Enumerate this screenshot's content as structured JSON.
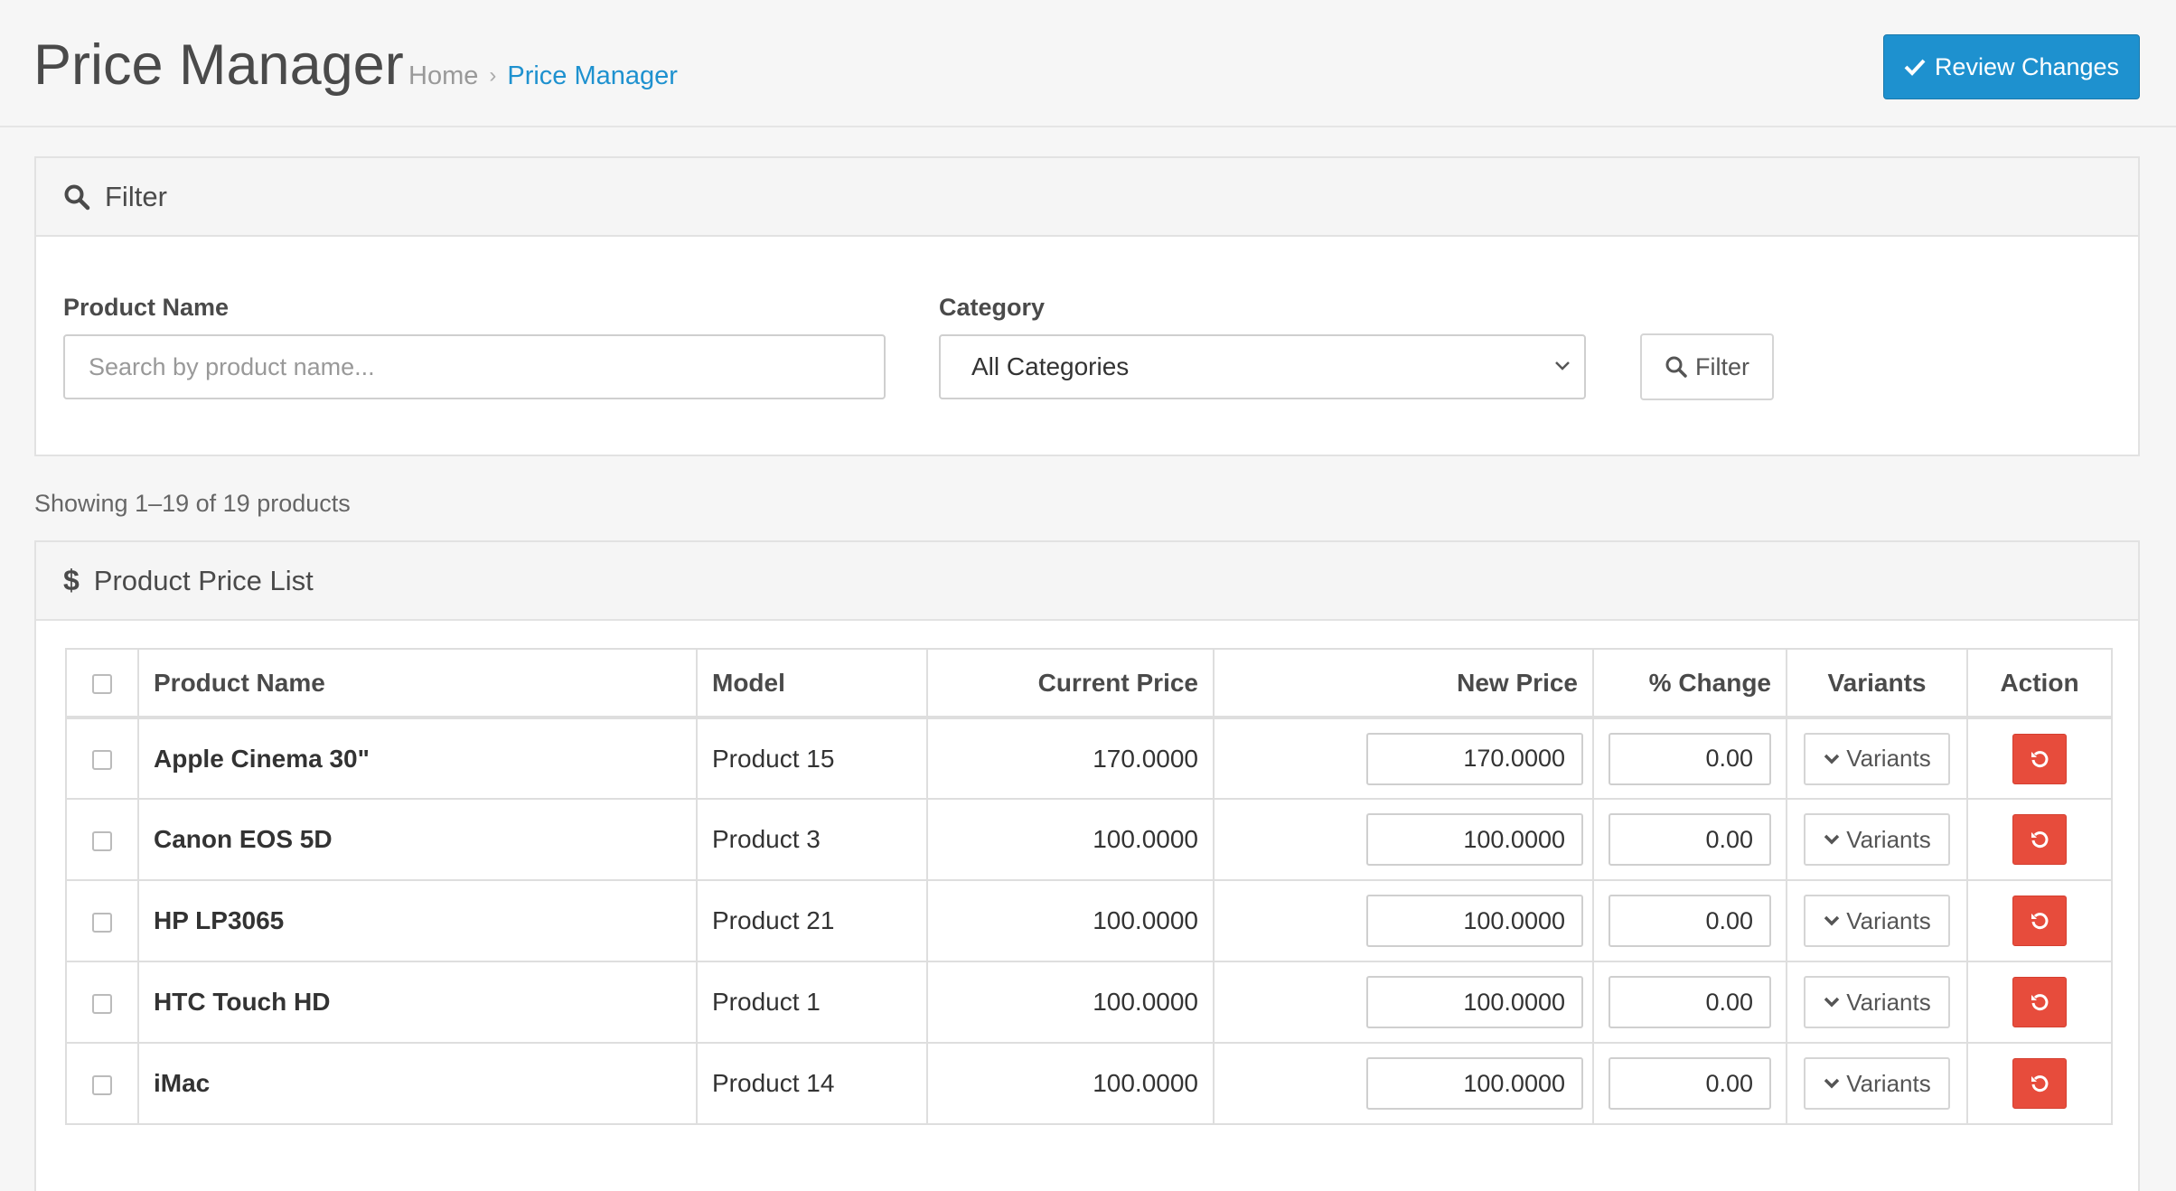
{
  "header": {
    "title": "Price Manager",
    "breadcrumb": [
      {
        "label": "Home"
      },
      {
        "label": "Price Manager"
      }
    ],
    "review_button": "Review Changes"
  },
  "filter": {
    "title": "Filter",
    "product_name_label": "Product Name",
    "product_name_placeholder": "Search by product name...",
    "product_name_value": "",
    "category_label": "Category",
    "category_selected": "All Categories",
    "filter_button": "Filter"
  },
  "summary": {
    "showing_text": "Showing 1–19 of 19 products"
  },
  "list": {
    "title": "Product Price List",
    "columns": {
      "product_name": "Product Name",
      "model": "Model",
      "current_price": "Current Price",
      "new_price": "New Price",
      "pct_change": "% Change",
      "variants": "Variants",
      "action": "Action"
    },
    "variants_label": "Variants",
    "rows": [
      {
        "name": "Apple Cinema 30\"",
        "model": "Product 15",
        "current_price": "170.0000",
        "new_price": "170.0000",
        "pct_change": "0.00"
      },
      {
        "name": "Canon EOS 5D",
        "model": "Product 3",
        "current_price": "100.0000",
        "new_price": "100.0000",
        "pct_change": "0.00"
      },
      {
        "name": "HP LP3065",
        "model": "Product 21",
        "current_price": "100.0000",
        "new_price": "100.0000",
        "pct_change": "0.00"
      },
      {
        "name": "HTC Touch HD",
        "model": "Product 1",
        "current_price": "100.0000",
        "new_price": "100.0000",
        "pct_change": "0.00"
      },
      {
        "name": "iMac",
        "model": "Product 14",
        "current_price": "100.0000",
        "new_price": "100.0000",
        "pct_change": "0.00"
      }
    ]
  },
  "colors": {
    "primary": "#1e91cf",
    "danger": "#e74c3c",
    "background": "#f6f6f6"
  },
  "icons": [
    "check-icon",
    "search-icon",
    "dollar-icon",
    "chevron-down-icon",
    "undo-icon"
  ]
}
